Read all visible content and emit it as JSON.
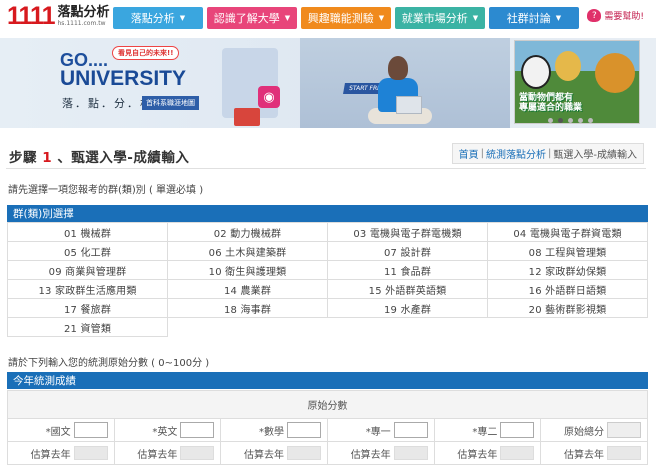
{
  "header": {
    "logo_number": "1111",
    "logo_name": "落點分析",
    "logo_url": "hs.1111.com.tw",
    "nav": [
      {
        "label": "落點分析",
        "color": "#3aa6df",
        "width": 90
      },
      {
        "label": "認識了解大學",
        "color": "#e8457a",
        "width": 90
      },
      {
        "label": "興趣職能測驗",
        "color": "#f08a1d",
        "width": 90
      },
      {
        "label": "就業市場分析",
        "color": "#3bb3a4",
        "width": 90
      },
      {
        "label": "社群討論",
        "color": "#2c8ad0",
        "width": 90
      }
    ],
    "help_label": "需要幫助!"
  },
  "banner": {
    "go": "GO....",
    "university": "UNIVERSITY",
    "bubble": "看見自己的未來!!",
    "points": "落．點．分．析",
    "map_tag": "首科系職涯地圖",
    "start_sign": "START FRESH"
  },
  "ad": {
    "text_line1": "當動物們都有",
    "text_line2": "專屬適合的職業"
  },
  "step": {
    "prefix": "步驟",
    "number": "1",
    "title": "、甄選入學-成績輸入"
  },
  "breadcrumb": {
    "home": "首頁",
    "sep": "|",
    "link": "統測落點分析",
    "current": "甄選入學-成績輸入"
  },
  "instructions": {
    "select_group": "請先選擇一項您報考的群(類)別 ( 單選必填 )",
    "enter_scores": "請於下列輸入您的統測原始分數 ( 0~100分 )"
  },
  "group_panel": {
    "title": "群(類)別選擇",
    "groups": [
      "01 機械群",
      "02 動力機械群",
      "03 電機與電子群電機類",
      "04 電機與電子群資電類",
      "05 化工群",
      "06 土木與建築群",
      "07 設計群",
      "08 工程與管理類",
      "09 商業與管理群",
      "10 衛生與護理類",
      "11 食品群",
      "12 家政群幼保類",
      "13 家政群生活應用類",
      "14 農業群",
      "15 外語群英語類",
      "16 外語群日語類",
      "17 餐旅群",
      "18 海事群",
      "19 水產群",
      "20 藝術群影視類",
      "21 資管類"
    ]
  },
  "score_panel": {
    "title": "今年統測成績",
    "raw_label": "原始分數",
    "subjects": [
      "*國文",
      "*英文",
      "*數學",
      "*專一",
      "*專二",
      "原始總分"
    ],
    "prev_label": "估算去年"
  }
}
